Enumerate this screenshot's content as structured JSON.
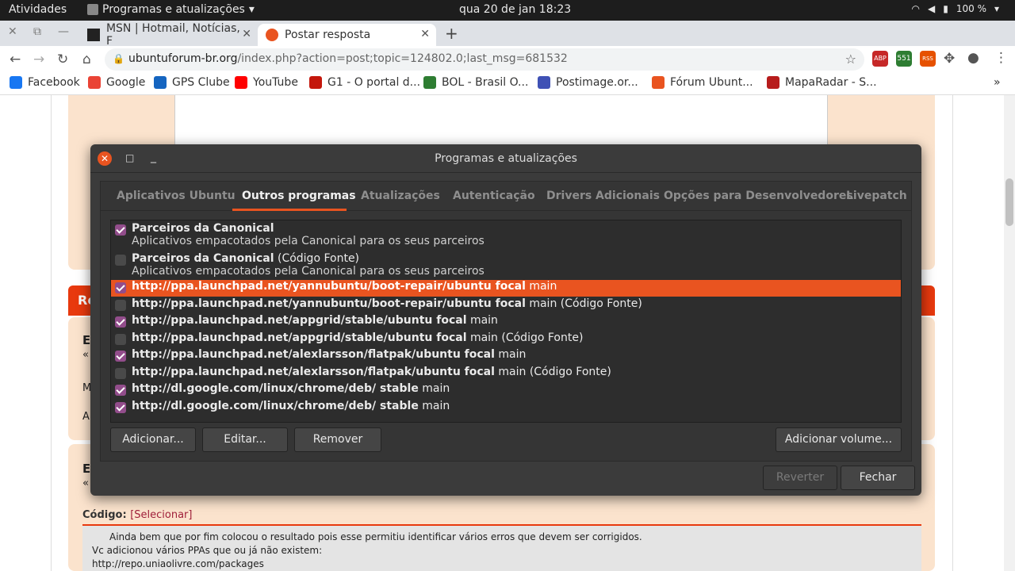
{
  "topbar": {
    "activities": "Atividades",
    "app_name": "Programas e atualizações",
    "clock": "qua 20 de jan  18:23",
    "battery": "100 %"
  },
  "browser": {
    "tabs": [
      {
        "title": "MSN | Hotmail, Notícias, F"
      },
      {
        "title": "Postar resposta"
      }
    ],
    "url_host": "ubuntuforum-br.org",
    "url_path": "/index.php?action=post;topic=124802.0;last_msg=681532",
    "extensions": [
      {
        "label": "ABP 1",
        "color": "#c62828"
      },
      {
        "label": "551",
        "color": "#2e7d32"
      },
      {
        "label": "RSS",
        "color": "#e65100"
      }
    ],
    "bookmarks": [
      {
        "label": "Facebook",
        "color": "#1877f2"
      },
      {
        "label": "Google",
        "color": "#ea4335"
      },
      {
        "label": "GPS Clube",
        "color": "#1565c0"
      },
      {
        "label": "YouTube",
        "color": "#ff0000"
      },
      {
        "label": "G1 - O portal d...",
        "color": "#c4170c"
      },
      {
        "label": "BOL - Brasil O...",
        "color": "#2e7d32"
      },
      {
        "label": "Postimage.or...",
        "color": "#3f51b5"
      },
      {
        "label": "Fórum Ubunt...",
        "color": "#e95420"
      },
      {
        "label": "MapaRadar - S...",
        "color": "#b71c1c"
      }
    ],
    "overflow": "»"
  },
  "page": {
    "red_heading": "Re",
    "left_letters": [
      "E",
      "«",
      "M",
      "A",
      "E",
      "«"
    ],
    "code_label": "Código:",
    "code_select": "[Selecionar]",
    "code_lines": [
      "Ainda bem que por fim colocou o resultado pois esse permitiu identificar vários erros que devem ser corrigidos.",
      "Vc adicionou vários PPAs que ou já não existem:",
      "http://repo.uniaolivre.com/packages"
    ]
  },
  "dialog": {
    "title": "Programas e atualizações",
    "tabs": [
      "Aplicativos Ubuntu",
      "Outros programas",
      "Atualizações",
      "Autenticação",
      "Drivers Adicionais",
      "Opções para Desenvolvedores",
      "Livepatch"
    ],
    "active_tab": "Outros programas",
    "partners": [
      {
        "title": "Parceiros da Canonical",
        "suffix": "",
        "desc": "Aplicativos empacotados pela Canonical para os seus parceiros",
        "checked": true
      },
      {
        "title": "Parceiros da Canonical",
        "suffix": " (Código Fonte)",
        "desc": "Aplicativos empacotados pela Canonical para os seus parceiros",
        "checked": false
      }
    ],
    "sources": [
      {
        "url": "http://ppa.launchpad.net/yannubuntu/boot-repair/ubuntu focal",
        "comp": " main",
        "checked": true,
        "selected": true
      },
      {
        "url": "http://ppa.launchpad.net/yannubuntu/boot-repair/ubuntu focal",
        "comp": " main (Código Fonte)",
        "checked": false,
        "selected": false
      },
      {
        "url": "http://ppa.launchpad.net/appgrid/stable/ubuntu focal",
        "comp": " main",
        "checked": true,
        "selected": false
      },
      {
        "url": "http://ppa.launchpad.net/appgrid/stable/ubuntu focal",
        "comp": " main (Código Fonte)",
        "checked": false,
        "selected": false
      },
      {
        "url": "http://ppa.launchpad.net/alexlarsson/flatpak/ubuntu focal",
        "comp": " main",
        "checked": true,
        "selected": false
      },
      {
        "url": "http://ppa.launchpad.net/alexlarsson/flatpak/ubuntu focal",
        "comp": " main (Código Fonte)",
        "checked": false,
        "selected": false
      },
      {
        "url": "http://dl.google.com/linux/chrome/deb/ stable",
        "comp": " main",
        "checked": true,
        "selected": false
      },
      {
        "url": "http://dl.google.com/linux/chrome/deb/ stable",
        "comp": " main",
        "checked": true,
        "selected": false
      }
    ],
    "buttons": {
      "add": "Adicionar...",
      "edit": "Editar...",
      "remove": "Remover",
      "add_volume": "Adicionar volume...",
      "revert": "Reverter",
      "close": "Fechar"
    }
  }
}
